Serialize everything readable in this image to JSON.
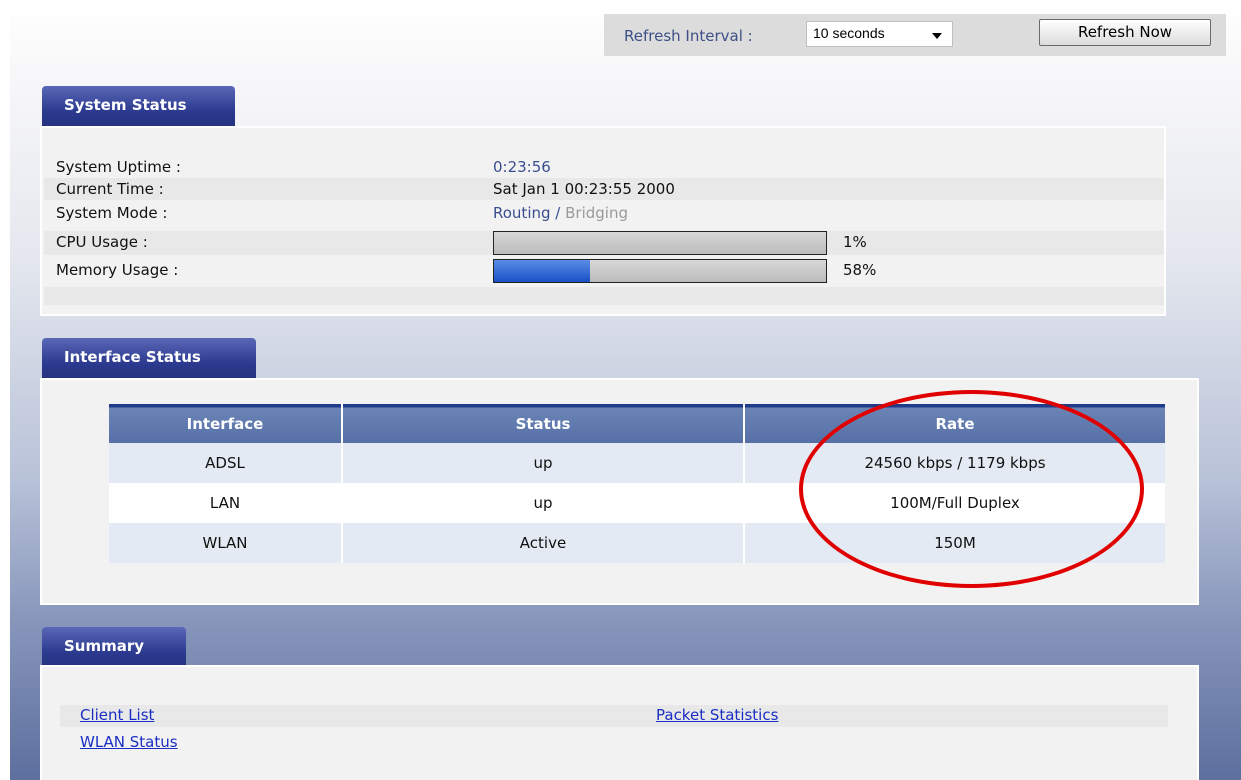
{
  "refresh": {
    "interval_label": "Refresh Interval :",
    "interval_value": "10 seconds",
    "refresh_now_label": "Refresh Now"
  },
  "system_status": {
    "title": "System Status",
    "uptime_label": "System Uptime :",
    "uptime_value": "0:23:56",
    "time_label": "Current Time :",
    "time_value": "Sat Jan 1 00:23:55 2000",
    "mode_label": "System Mode :",
    "mode_active": "Routing",
    "mode_separator": " / ",
    "mode_inactive": "Bridging",
    "cpu_label": "CPU Usage :",
    "cpu_percent_text": "1%",
    "cpu_percent": 1,
    "mem_label": "Memory Usage :",
    "mem_percent_text": "58%",
    "mem_percent": 58,
    "memory_bar_fill_fraction": 0.29
  },
  "interface_status": {
    "title": "Interface Status",
    "columns": [
      "Interface",
      "Status",
      "Rate"
    ],
    "rows": [
      {
        "interface": "ADSL",
        "status": "up",
        "rate": "24560 kbps / 1179 kbps"
      },
      {
        "interface": "LAN",
        "status": "up",
        "rate": "100M/Full Duplex"
      },
      {
        "interface": "WLAN",
        "status": "Active",
        "rate": "150M"
      }
    ]
  },
  "summary": {
    "title": "Summary",
    "links": {
      "client_list": "Client List",
      "packet_statistics": "Packet Statistics",
      "wlan_status": "WLAN Status"
    }
  },
  "colors": {
    "tab_blue": "#2c3a8f",
    "link_blue": "#1a2ec4",
    "annotation_red": "#e00000",
    "bar_fill_blue": "#1a4fc6"
  }
}
